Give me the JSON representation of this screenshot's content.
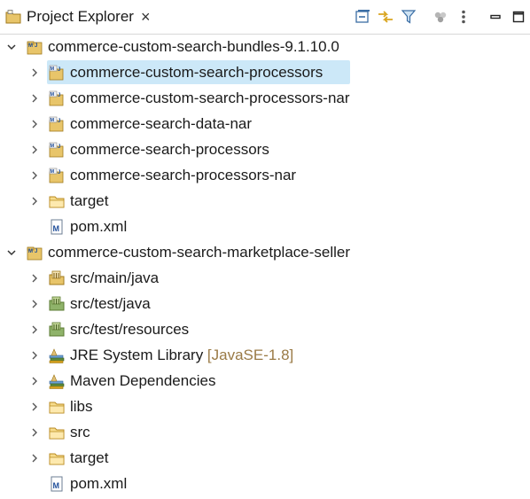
{
  "view": {
    "title": "Project Explorer",
    "close_glyph": "×",
    "toolbar": [
      {
        "name": "collapse-all-icon"
      },
      {
        "name": "link-with-editor-icon"
      },
      {
        "name": "filter-icon"
      },
      {
        "name": "focus-workspace-icon"
      },
      {
        "name": "view-menu-icon"
      },
      {
        "name": "minimize-icon"
      },
      {
        "name": "maximize-icon"
      }
    ]
  },
  "tree": {
    "project1": {
      "label": "commerce-custom-search-bundles-9.1.10.0",
      "children": [
        {
          "label": "commerce-custom-search-processors",
          "icon": "maven-module-icon",
          "selected": true
        },
        {
          "label": "commerce-custom-search-processors-nar",
          "icon": "maven-module-icon"
        },
        {
          "label": "commerce-search-data-nar",
          "icon": "maven-module-icon"
        },
        {
          "label": "commerce-search-processors",
          "icon": "maven-module-icon"
        },
        {
          "label": "commerce-search-processors-nar",
          "icon": "maven-module-icon"
        },
        {
          "label": "target",
          "icon": "folder-icon"
        },
        {
          "label": "pom.xml",
          "icon": "maven-pom-icon"
        }
      ]
    },
    "project2": {
      "label": "commerce-custom-search-marketplace-seller",
      "children": [
        {
          "label": "src/main/java",
          "icon": "source-folder-icon"
        },
        {
          "label": "src/test/java",
          "icon": "test-source-folder-icon"
        },
        {
          "label": "src/test/resources",
          "icon": "test-source-folder-icon"
        },
        {
          "label": "JRE System Library",
          "decoration": "[JavaSE-1.8]",
          "icon": "library-icon"
        },
        {
          "label": "Maven Dependencies",
          "icon": "library-icon"
        },
        {
          "label": "libs",
          "icon": "folder-icon"
        },
        {
          "label": "src",
          "icon": "folder-icon"
        },
        {
          "label": "target",
          "icon": "folder-icon"
        },
        {
          "label": "pom.xml",
          "icon": "maven-pom-icon"
        }
      ]
    }
  }
}
